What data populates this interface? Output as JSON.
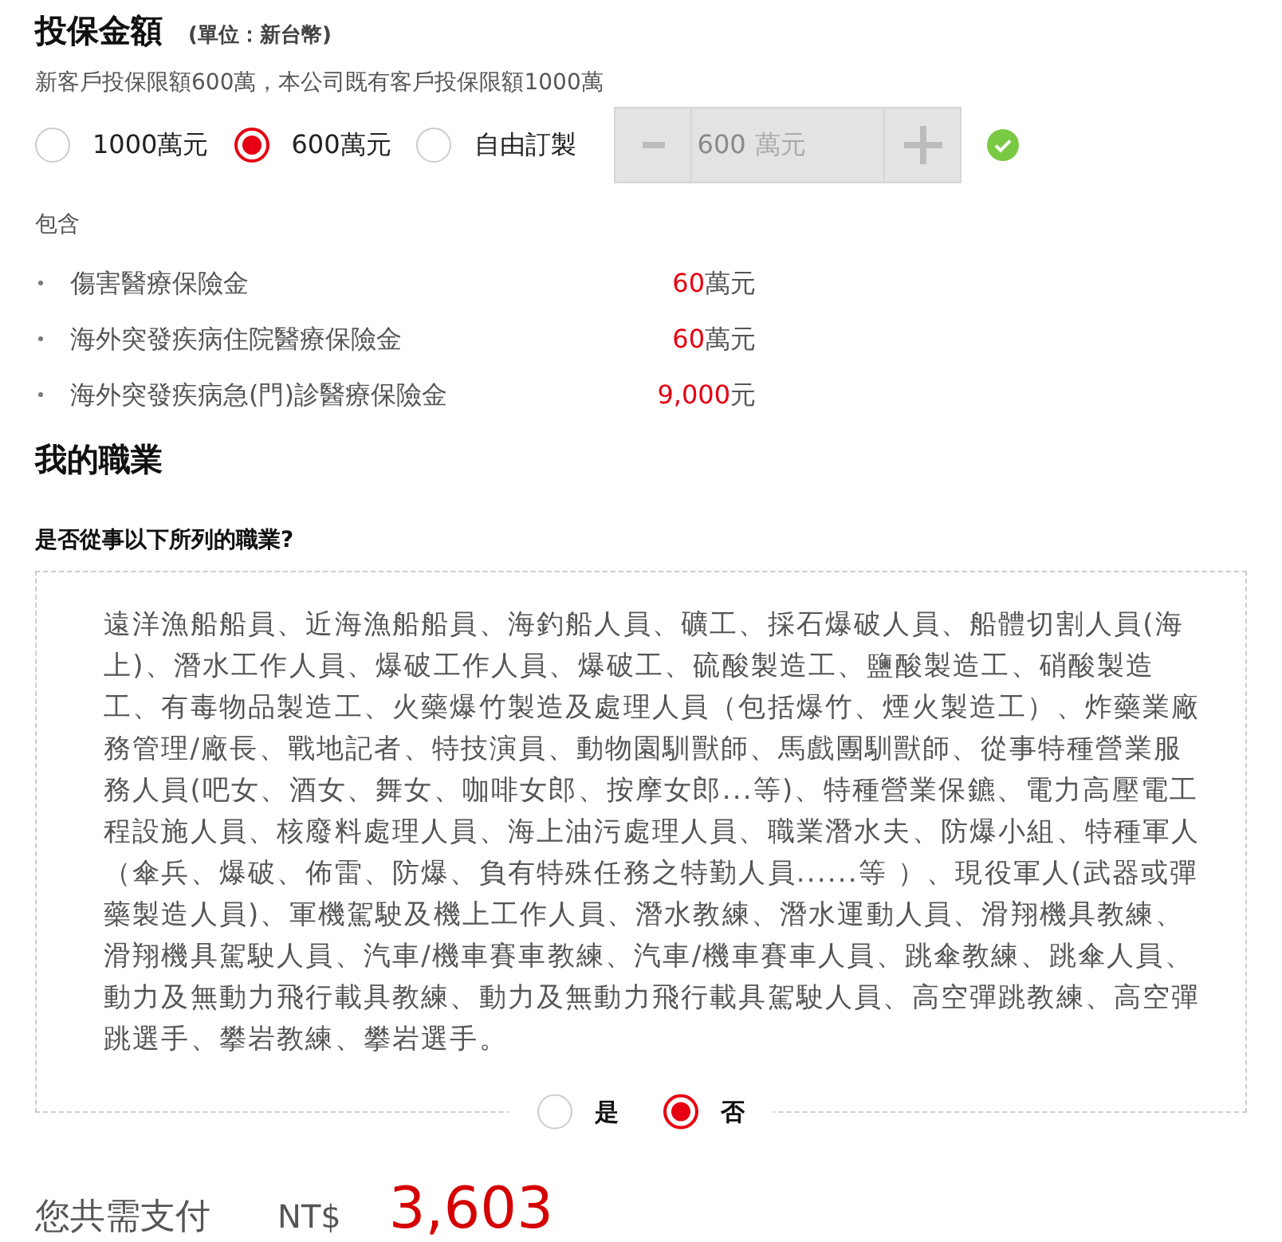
{
  "insured_amount": {
    "title": "投保金額",
    "unit_note": "(單位：新台幣)",
    "limit_note": "新客戶投保限額600萬，本公司既有客戶投保限額1000萬",
    "options": [
      {
        "label": "1000萬元",
        "selected": false
      },
      {
        "label": "600萬元",
        "selected": true
      },
      {
        "label": "自由訂製",
        "selected": false
      }
    ],
    "custom_amount": {
      "value": "600",
      "unit": "萬元",
      "disabled": true
    },
    "valid": true
  },
  "coverage": {
    "title": "包含",
    "items": [
      {
        "name": "傷害醫療保險金",
        "amount": "60萬元"
      },
      {
        "name": "海外突發疾病住院醫療保險金",
        "amount": "60萬元"
      },
      {
        "name": "海外突發疾病急(門)診醫療保險金",
        "amount": "9,000元"
      }
    ]
  },
  "occupation": {
    "title": "我的職業",
    "question": "是否從事以下所列的職業?",
    "list_text": "遠洋漁船船員、近海漁船船員、海釣船人員、礦工、採石爆破人員、船體切割人員(海上)、潛水工作人員、爆破工作人員、爆破工、硫酸製造工、鹽酸製造工、硝酸製造工、有毒物品製造工、火藥爆竹製造及處理人員（包括爆竹、煙火製造工）、炸藥業廠務管理/廠長、戰地記者、特技演員、動物園馴獸師、馬戲團馴獸師、從事特種營業服務人員(吧女、酒女、舞女、咖啡女郎、按摩女郎...等)、特種營業保鑣、電力高壓電工程設施人員、核廢料處理人員、海上油污處理人員、職業潛水夫、防爆小組、特種軍人（傘兵、爆破、佈雷、防爆、負有特殊任務之特勤人員......等 ）、現役軍人(武器或彈藥製造人員)、軍機駕駛及機上工作人員、潛水教練、潛水運動人員、滑翔機具教練、滑翔機具駕駛人員、汽車/機車賽車教練、汽車/機車賽車人員、跳傘教練、跳傘人員、動力及無動力飛行載具教練、動力及無動力飛行載具駕駛人員、高空彈跳教練、高空彈跳選手、攀岩教練、攀岩選手。",
    "answers": [
      {
        "label": "是",
        "selected": false
      },
      {
        "label": "否",
        "selected": true
      }
    ]
  },
  "total": {
    "label": "您共需支付",
    "currency": "NT$",
    "amount": "3,603"
  }
}
